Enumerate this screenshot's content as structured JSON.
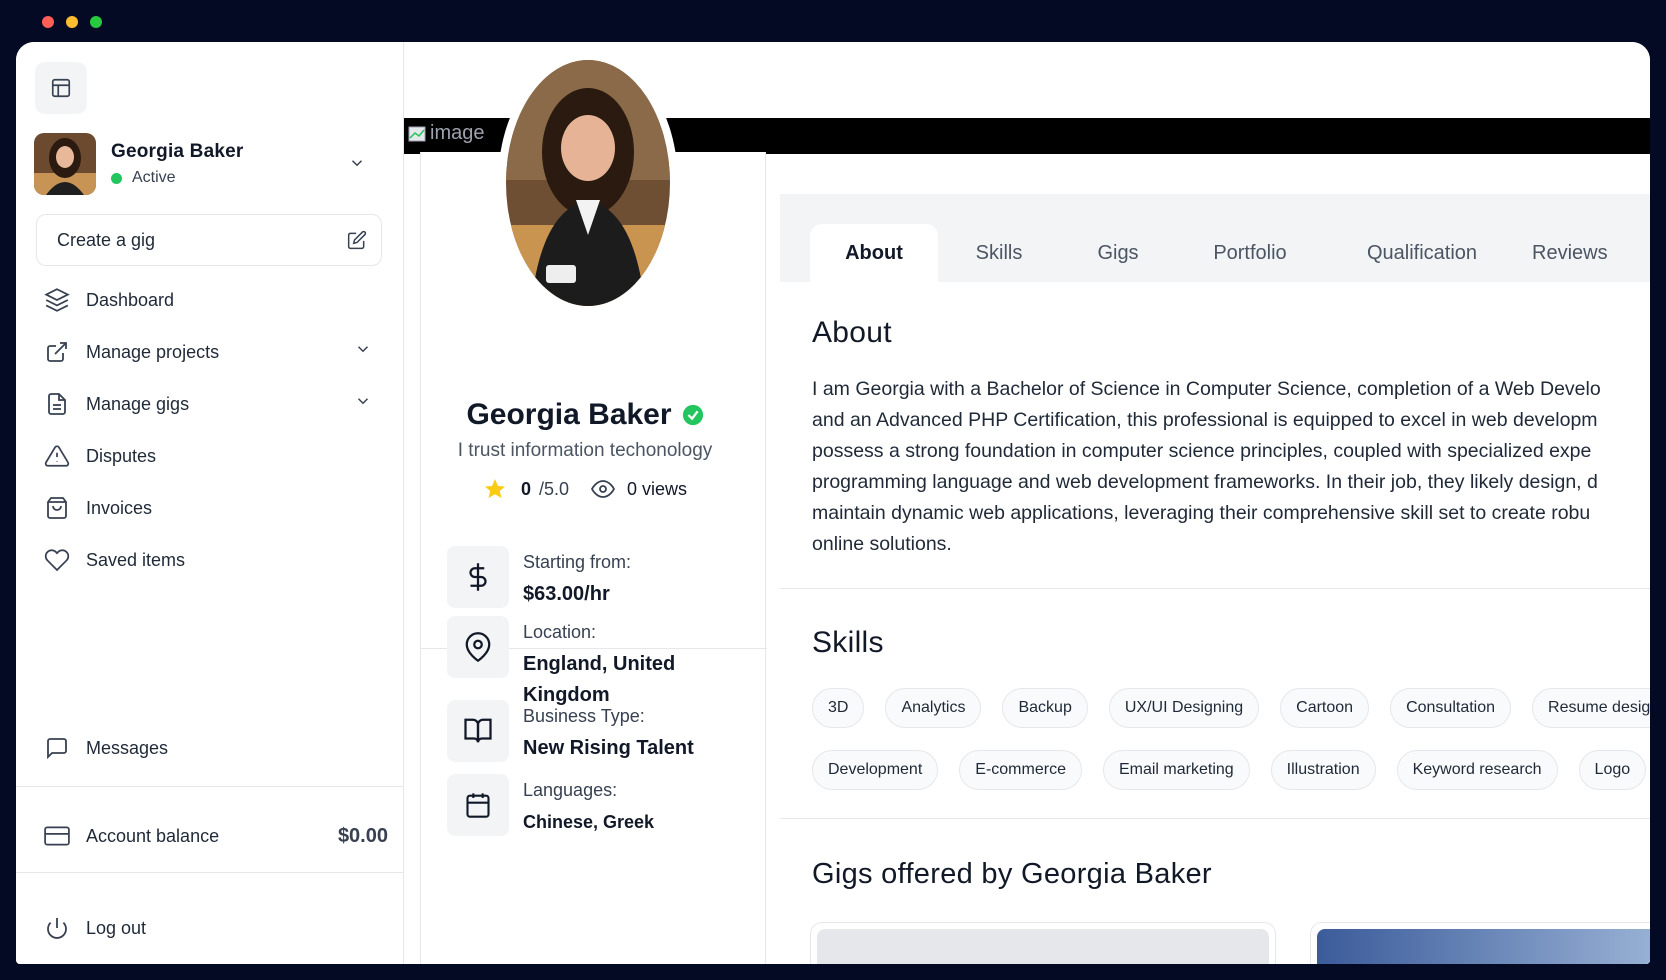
{
  "colors": {
    "accent_green": "#22c55e",
    "star": "#facc15",
    "window_dark": "#050a24"
  },
  "sidebar": {
    "user_name": "Georgia Baker",
    "user_status": "Active",
    "create_gig_label": "Create a gig",
    "items": [
      {
        "label": "Dashboard",
        "icon": "layers-icon",
        "has_chevron": false
      },
      {
        "label": "Manage projects",
        "icon": "external-link-icon",
        "has_chevron": true
      },
      {
        "label": "Manage gigs",
        "icon": "document-icon",
        "has_chevron": true
      },
      {
        "label": "Disputes",
        "icon": "warning-icon",
        "has_chevron": false
      },
      {
        "label": "Invoices",
        "icon": "shopping-bag-icon",
        "has_chevron": false
      },
      {
        "label": "Saved items",
        "icon": "heart-icon",
        "has_chevron": false
      }
    ],
    "messages_label": "Messages",
    "balance_label": "Account balance",
    "balance_value": "$0.00",
    "logout_label": "Log out"
  },
  "cover": {
    "alt_text": "image"
  },
  "profile": {
    "name": "Georgia Baker",
    "tagline": "I trust information techonology",
    "rating": "0",
    "rating_max": "/5.0",
    "views": "0 views",
    "details": [
      {
        "label": "Starting from:",
        "value": "$63.00/hr",
        "icon": "dollar-icon"
      },
      {
        "label": "Location:",
        "value": "England, United Kingdom",
        "icon": "map-pin-icon"
      },
      {
        "label": "Business Type:",
        "value": "New Rising Talent",
        "icon": "book-open-icon"
      },
      {
        "label": "Languages:",
        "value": "Chinese, Greek",
        "icon": "calendar-icon"
      }
    ]
  },
  "tabs": [
    "About",
    "Skills",
    "Gigs",
    "Portfolio",
    "Qualification",
    "Reviews"
  ],
  "about": {
    "title": "About",
    "lines": [
      "I am Georgia with a Bachelor of Science in Computer Science, completion of a Web Develo",
      "and an Advanced PHP Certification, this professional is equipped to excel in web developm",
      "possess a strong foundation in computer science principles, coupled with specialized expe",
      "programming language and web development frameworks. In their job, they likely design, d",
      "maintain dynamic web applications, leveraging their comprehensive skill set to create robu",
      "online solutions."
    ]
  },
  "skills": {
    "title": "Skills",
    "row1": [
      "3D",
      "Analytics",
      "Backup",
      "UX/UI Designing",
      "Cartoon",
      "Consultation",
      "Resume design"
    ],
    "row2": [
      "Development",
      "E-commerce",
      "Email marketing",
      "Illustration",
      "Keyword research",
      "Logo"
    ]
  },
  "gigs": {
    "title": "Gigs offered by Georgia Baker"
  }
}
